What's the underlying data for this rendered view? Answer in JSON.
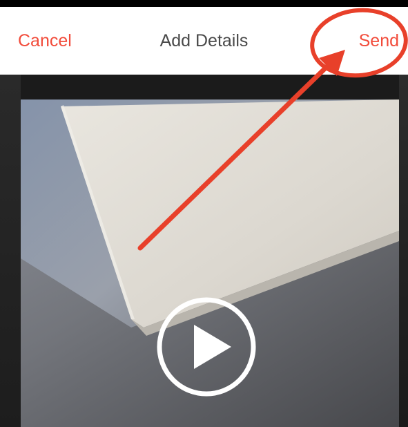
{
  "nav": {
    "cancel_label": "Cancel",
    "title": "Add Details",
    "send_label": "Send"
  },
  "colors": {
    "accent": "#f24b3a",
    "annotation": "#e8402a"
  },
  "icons": {
    "play": "play-icon"
  }
}
